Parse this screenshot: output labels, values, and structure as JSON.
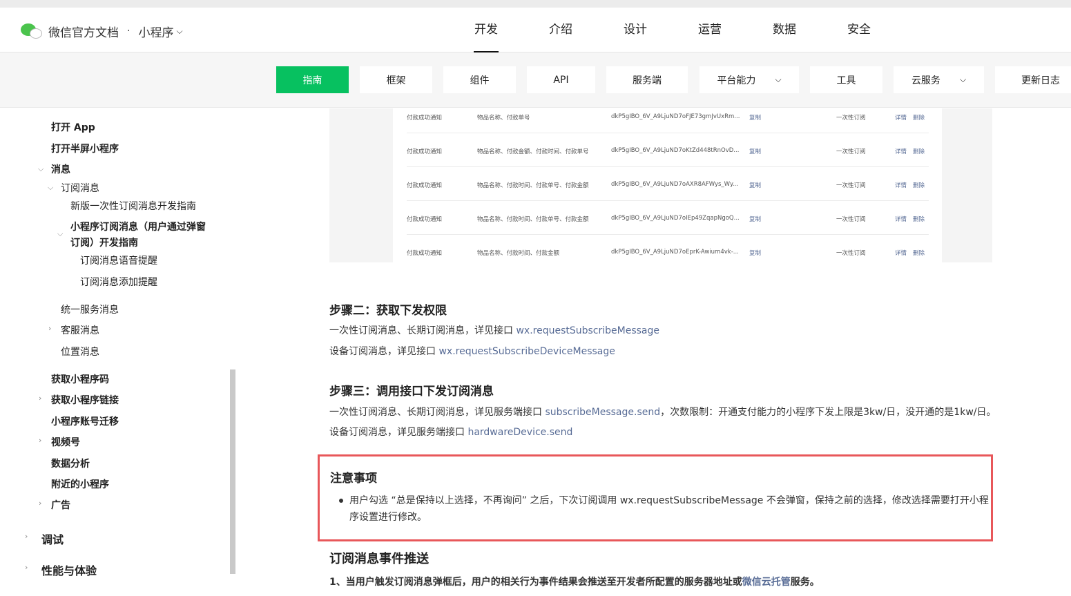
{
  "header": {
    "brand": "微信官方文档",
    "separator": "·",
    "product": "小程序",
    "nav": [
      "开发",
      "介绍",
      "设计",
      "运营",
      "数据",
      "安全"
    ],
    "active_nav": "开发"
  },
  "subnav": [
    {
      "label": "指南",
      "active": true
    },
    {
      "label": "框架"
    },
    {
      "label": "组件"
    },
    {
      "label": "API"
    },
    {
      "label": "服务端"
    },
    {
      "label": "平台能力",
      "dropdown": true
    },
    {
      "label": "工具"
    },
    {
      "label": "云服务",
      "dropdown": true
    },
    {
      "label": "更新日志"
    }
  ],
  "sidebar": {
    "items": [
      {
        "label": "打开 App"
      },
      {
        "label": "打开半屏小程序"
      },
      {
        "label": "消息"
      },
      {
        "label": "订阅消息"
      },
      {
        "label": "新版一次性订阅消息开发指南"
      },
      {
        "label": "小程序订阅消息（用户通过弹窗"
      },
      {
        "label": "订阅）开发指南"
      },
      {
        "label": "订阅消息语音提醒"
      },
      {
        "label": "订阅消息添加提醒"
      },
      {
        "label": "统一服务消息"
      },
      {
        "label": "客服消息"
      },
      {
        "label": "位置消息"
      },
      {
        "label": "获取小程序码"
      },
      {
        "label": "获取小程序链接"
      },
      {
        "label": "小程序账号迁移"
      },
      {
        "label": "视频号"
      },
      {
        "label": "数据分析"
      },
      {
        "label": "附近的小程序"
      },
      {
        "label": "广告"
      },
      {
        "label": "调试"
      },
      {
        "label": "性能与体验"
      }
    ]
  },
  "template_table": {
    "rows": [
      {
        "title": "付款成功通知",
        "keywords": "物品名称、付款单号",
        "id": "dkP5gIBO_6V_A9LjuND7oFJE73gmJvUxRm...",
        "copy": "复制",
        "type": "一次性订阅",
        "detail": "详情",
        "delete": "删除"
      },
      {
        "title": "付款成功通知",
        "keywords": "物品名称、付款金额、付款时间、付款单号",
        "id": "dkP5gIBO_6V_A9LjuND7oKtZd448tRnOvD...",
        "copy": "复制",
        "type": "一次性订阅",
        "detail": "详情",
        "delete": "删除"
      },
      {
        "title": "付款成功通知",
        "keywords": "物品名称、付款时间、付款单号、付款金额",
        "id": "dkP5gIBO_6V_A9LjuND7oAXR8AFWys_Wy...",
        "copy": "复制",
        "type": "一次性订阅",
        "detail": "详情",
        "delete": "删除"
      },
      {
        "title": "付款成功通知",
        "keywords": "物品名称、付款时间、付款单号、付款金额",
        "id": "dkP5gIBO_6V_A9LjuND7oIEp49ZqapNgoQ...",
        "copy": "复制",
        "type": "一次性订阅",
        "detail": "详情",
        "delete": "删除"
      },
      {
        "title": "付款成功通知",
        "keywords": "物品名称、付款时间、付款金额",
        "id": "dkP5gIBO_6V_A9LjuND7oEprK-Awium4vk-...",
        "copy": "复制",
        "type": "一次性订阅",
        "detail": "详情",
        "delete": "删除"
      }
    ]
  },
  "content": {
    "step2_title": "步骤二：获取下发权限",
    "step2_p1_text": "一次性订阅消息、长期订阅消息，详见接口 ",
    "step2_p1_link": "wx.requestSubscribeMessage",
    "step2_p2_text": "设备订阅消息，详见接口 ",
    "step2_p2_link": "wx.requestSubscribeDeviceMessage",
    "step3_title": "步骤三：调用接口下发订阅消息",
    "step3_p1_text": "一次性订阅消息、长期订阅消息，详见服务端接口 ",
    "step3_p1_link": "subscribeMessage.send",
    "step3_p1_suffix": "，次数限制：开通支付能力的小程序下发上限是3kw/日，没开通的是1kw/日。",
    "step3_p2_text": "设备订阅消息，详见服务端接口 ",
    "step3_p2_link": "hardwareDevice.send",
    "notice_title": "注意事项",
    "notice_text": "用户勾选 “总是保持以上选择，不再询问” 之后，下次订阅调用 wx.requestSubscribeMessage 不会弹窗，保持之前的选择，修改选择需要打开小程序设置进行修改。",
    "event_title": "订阅消息事件推送",
    "event_p1_text": "1、当用户触发订阅消息弹框后，用户的相关行为事件结果会推送至开发者所配置的服务器地址或",
    "event_p1_link": "微信云托管",
    "event_p1_suffix": "服务。"
  }
}
